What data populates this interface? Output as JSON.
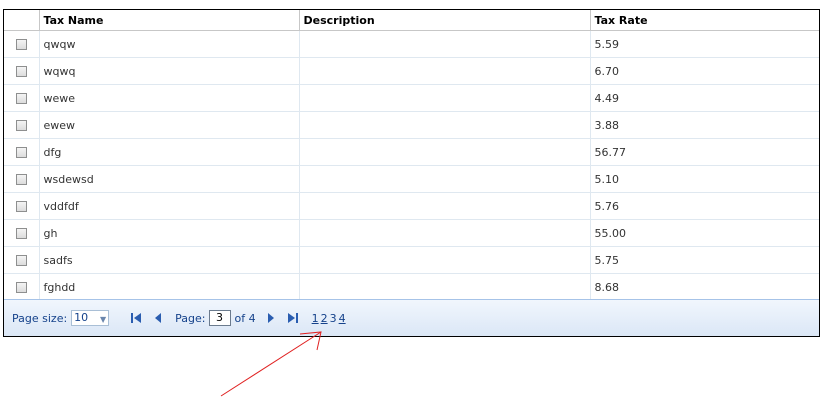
{
  "columns": {
    "name": "Tax Name",
    "description": "Description",
    "rate": "Tax Rate"
  },
  "rows": [
    {
      "name": "qwqw",
      "description": "",
      "rate": "5.59"
    },
    {
      "name": "wqwq",
      "description": "",
      "rate": "6.70"
    },
    {
      "name": "wewe",
      "description": "",
      "rate": "4.49"
    },
    {
      "name": "ewew",
      "description": "",
      "rate": "3.88"
    },
    {
      "name": "dfg",
      "description": "",
      "rate": "56.77"
    },
    {
      "name": "wsdewsd",
      "description": "",
      "rate": "5.10"
    },
    {
      "name": "vddfdf",
      "description": "",
      "rate": "5.76"
    },
    {
      "name": "gh",
      "description": "",
      "rate": "55.00"
    },
    {
      "name": "sadfs",
      "description": "",
      "rate": "5.75"
    },
    {
      "name": "fghdd",
      "description": "",
      "rate": "8.68"
    }
  ],
  "pager": {
    "page_size_label": "Page size:",
    "page_size_value": "10",
    "page_label": "Page:",
    "current_page": "3",
    "of_label": "of 4",
    "page_links": [
      "1",
      "2",
      "3",
      "4"
    ]
  },
  "colors": {
    "pager_bg_top": "#f1f6fd",
    "pager_bg_bottom": "#dbe7f6",
    "pager_text": "#15428b",
    "nav_icon": "#2a5db0",
    "annotation_arrow": "#e02020"
  },
  "icons": {
    "first": "first-page-icon",
    "prev": "prev-page-icon",
    "next": "next-page-icon",
    "last": "last-page-icon"
  }
}
